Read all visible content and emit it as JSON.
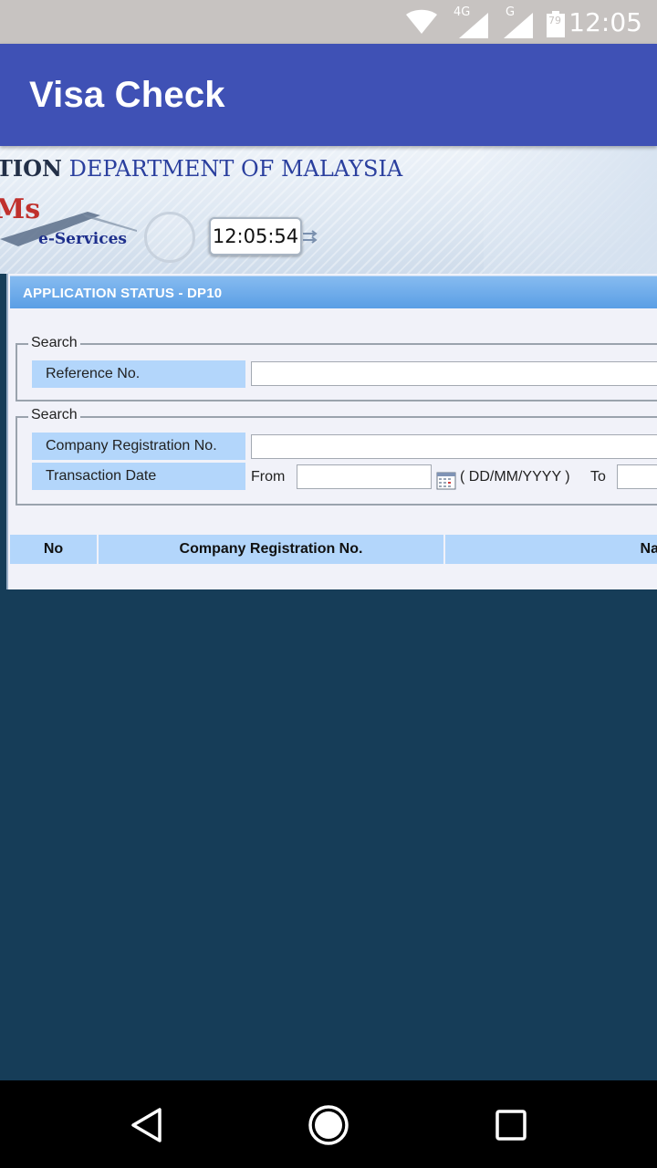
{
  "status_bar": {
    "network_4g": "4G",
    "network_g": "G",
    "battery_level": "79",
    "time": "12:05",
    "icons": [
      "wifi-icon",
      "cell-signal-icon",
      "cell-signal-icon",
      "battery-icon"
    ]
  },
  "app_bar": {
    "title": "Visa Check"
  },
  "banner": {
    "title_left": "TION",
    "title_right": "DEPARTMENT OF MALAYSIA",
    "logo": "Ms",
    "subtitle": "e-Services",
    "clock": "12:05:54"
  },
  "panel": {
    "header": "APPLICATION STATUS - DP10",
    "search1": {
      "legend": "Search",
      "reference_label": "Reference No.",
      "reference_value": ""
    },
    "search2": {
      "legend": "Search",
      "company_label": "Company Registration No.",
      "company_value": "",
      "date_label": "Transaction Date",
      "from_label": "From",
      "from_value": "",
      "date_format": "( DD/MM/YYYY )",
      "to_label": "To",
      "to_value": ""
    },
    "table": {
      "columns": [
        "No",
        "Company Registration No.",
        "Na"
      ]
    }
  },
  "colors": {
    "status_bar": "#c7c3c1",
    "app_bar": "#3f51b5",
    "page_background": "#163d58",
    "label_cell": "#b3d6fb",
    "panel_header": "#5a9ee5"
  }
}
